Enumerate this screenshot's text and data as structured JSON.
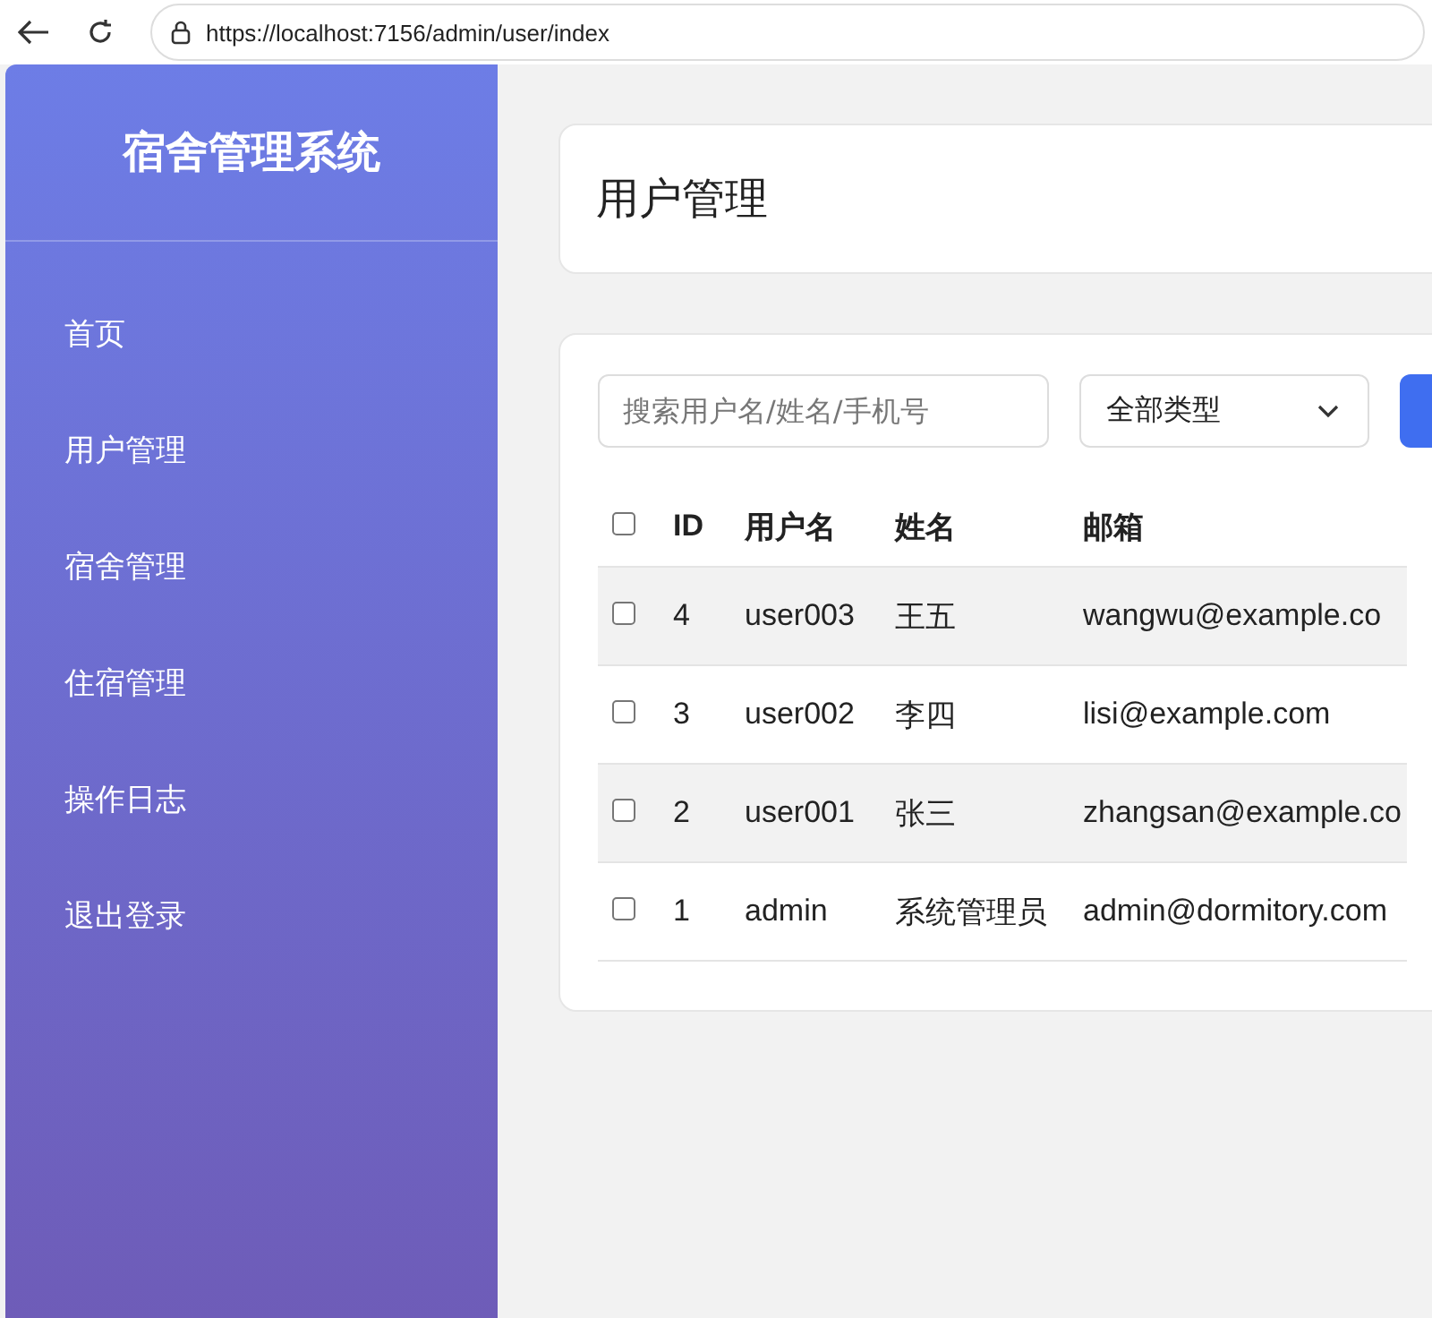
{
  "browser": {
    "url": "https://localhost:7156/admin/user/index"
  },
  "sidebar": {
    "title": "宿舍管理系统",
    "items": [
      {
        "label": "首页",
        "selected": false
      },
      {
        "label": "用户管理",
        "selected": false
      },
      {
        "label": "宿舍管理",
        "selected": false
      },
      {
        "label": "住宿管理",
        "selected": false
      },
      {
        "label": "操作日志",
        "selected": false
      },
      {
        "label": "退出登录",
        "selected": false
      }
    ]
  },
  "page_title": "用户管理",
  "filters": {
    "search": {
      "placeholder": "搜索用户名/姓名/手机号"
    },
    "type_select": {
      "value": "全部类型"
    }
  },
  "table": {
    "columns": [
      "ID",
      "用户名",
      "姓名",
      "邮箱"
    ],
    "all_checked": false,
    "rows": [
      {
        "checked": false,
        "cells": [
          "4",
          "user003",
          "王五",
          "wangwu@example.co"
        ]
      },
      {
        "checked": false,
        "cells": [
          "3",
          "user002",
          "李四",
          "lisi@example.com"
        ]
      },
      {
        "checked": false,
        "cells": [
          "2",
          "user001",
          "张三",
          "zhangsan@example.co"
        ]
      },
      {
        "checked": false,
        "cells": [
          "1",
          "admin",
          "系统管理员",
          "admin@dormitory.com"
        ]
      }
    ]
  }
}
